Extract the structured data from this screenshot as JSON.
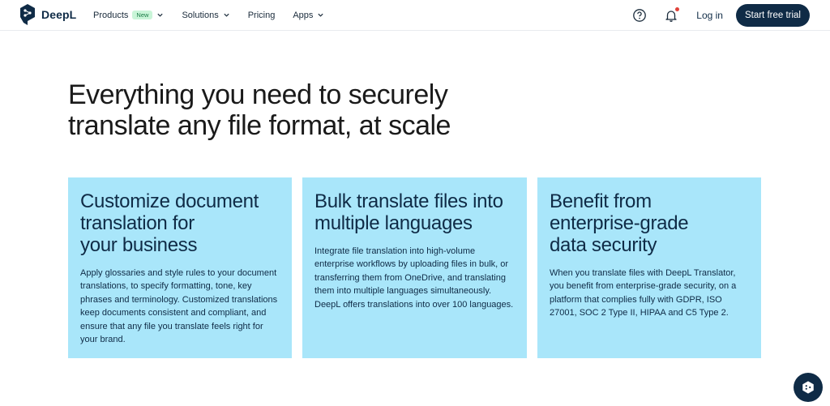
{
  "brand": {
    "name": "DeepL"
  },
  "nav": {
    "products": {
      "label": "Products",
      "badge": "New"
    },
    "solutions": {
      "label": "Solutions"
    },
    "pricing": {
      "label": "Pricing"
    },
    "apps": {
      "label": "Apps"
    },
    "login": "Log in",
    "cta": "Start free trial"
  },
  "hero": {
    "title_line1": "Everything you need to securely",
    "title_line2": "translate any file format, at scale"
  },
  "cards": [
    {
      "title_lines": [
        "Customize document",
        "translation for",
        "your business"
      ],
      "body": "Apply glossaries and style rules to your document translations, to specify formatting, tone, key phrases and terminology. Customized translations keep documents consistent and compliant, and ensure that any file you translate feels right for your brand."
    },
    {
      "title_lines": [
        "Bulk translate files into",
        "multiple languages"
      ],
      "body": "Integrate file translation into high-volume enterprise workflows by uploading files in bulk, or transferring them from OneDrive, and translating them into multiple languages simultaneously. DeepL offers translations into over 100 languages."
    },
    {
      "title_lines": [
        "Benefit from",
        "enterprise-grade",
        "data security"
      ],
      "body": "When you translate files with DeepL Translator, you benefit from enterprise-grade security, on a platform that complies fully with GDPR, ISO 27001, SOC 2 Type II, HIPAA and C5 Type 2."
    }
  ],
  "colors": {
    "brand_navy": "#0f2b46",
    "card_bg": "#a9e6fa",
    "badge_bg": "#c9f5d8",
    "notification_dot": "#e0423a"
  },
  "icons": {
    "logo": "deepl-logo-icon",
    "help": "help-circle-icon",
    "bell": "bell-icon",
    "chat": "chat-assistant-icon"
  }
}
